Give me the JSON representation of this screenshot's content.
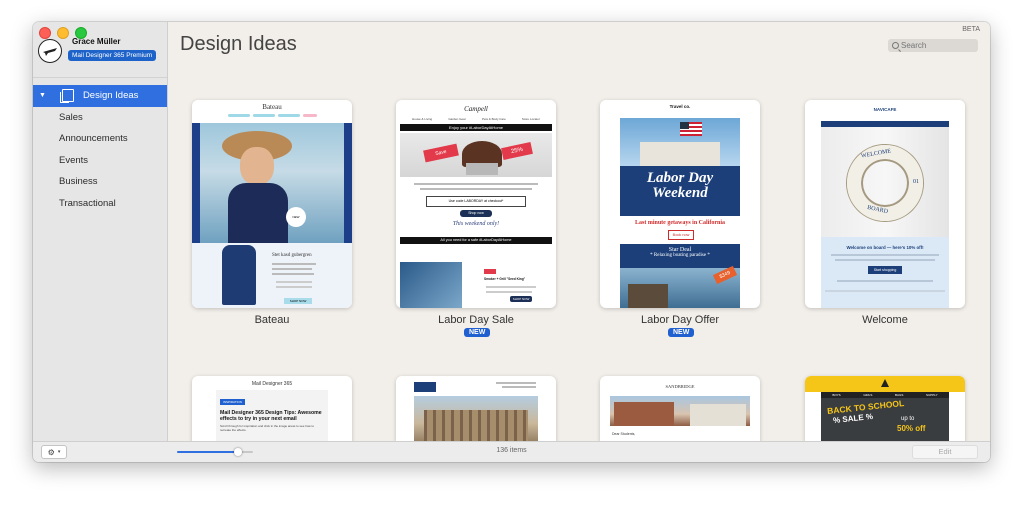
{
  "window": {
    "beta_label": "BETA",
    "page_title": "Design Ideas"
  },
  "account": {
    "name": "Grace Müller",
    "plan": "Mail Designer 365 Premium"
  },
  "sidebar": {
    "items": [
      {
        "label": "Design Ideas",
        "active": true
      },
      {
        "label": "Sales"
      },
      {
        "label": "Announcements"
      },
      {
        "label": "Events"
      },
      {
        "label": "Business"
      },
      {
        "label": "Transactional"
      }
    ]
  },
  "search": {
    "placeholder": "Search"
  },
  "cards": [
    {
      "label": "Bateau",
      "badge": "",
      "brand": "Bateau",
      "heading": "Stet kasd gubergren",
      "button": "SHOP NOW"
    },
    {
      "label": "Labor Day Sale",
      "badge": "NEW",
      "brand": "Campell",
      "banner": "Enjoy your #LaborDayAtHome",
      "code": "Use code LABORDAY at checkout*",
      "button": "Shop now",
      "tagline": "This weekend only!",
      "bottom_banner": "All you need for a safe #LaborDayAtHome",
      "item_title": "Smoker + Grill \"Seed King\"",
      "item_btn": "SHOP NOW"
    },
    {
      "label": "Labor Day Offer",
      "badge": "NEW",
      "brand": "Travel co.",
      "hero_line1": "Labor Day",
      "hero_line2": "Weekend",
      "subtitle": "Last minute getaways in California",
      "button": "Book now",
      "deal_title": "Star Deal",
      "deal_sub": "* Relaxing boating paradise *",
      "price_tag": "$349"
    },
    {
      "label": "Welcome",
      "badge": "",
      "brand": "NAVICAFE",
      "ring_text_top": "WELCOME",
      "ring_text_bottom": "BOARD",
      "ring_number": "01",
      "greeting": "Welcome on board — here's 10% off!",
      "button": "Start shopping"
    },
    {
      "label": "",
      "brand": "Mail Designer 365",
      "tag": "INSPIRATION",
      "title": "Mail Designer 365 Design Tips: Awesome effects to try in your next email",
      "body": "Scroll through for inspiration and click in the image areas to see how to recreate the effects."
    },
    {
      "label": ""
    },
    {
      "label": "",
      "brand": "SANDBRIDGE",
      "greeting": "Dear Students,"
    },
    {
      "label": "",
      "title_line1": "BACK TO SCHOOL",
      "title_line2": "% SALE %",
      "upto": "up to",
      "discount": "50% off",
      "nav": [
        "BOYS",
        "GIRLS",
        "BAGS",
        "SUPPLY"
      ]
    }
  ],
  "bottom": {
    "count": "136 items",
    "edit": "Edit",
    "zoom": 0.8
  },
  "colors": {
    "accent": "#2f6fe0",
    "badge": "#1f5fd0",
    "labor_blue": "#1c3f7a",
    "labor_red": "#d02b2b"
  }
}
